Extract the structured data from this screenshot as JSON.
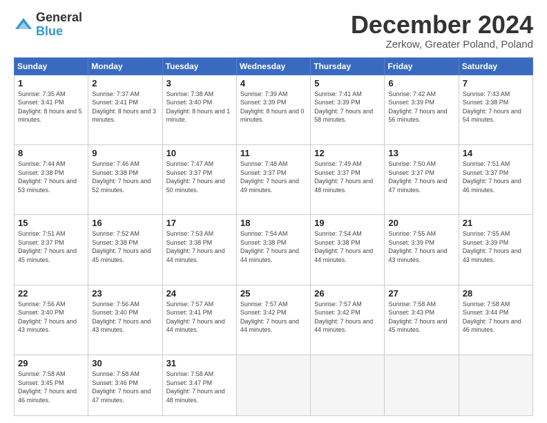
{
  "logo": {
    "general": "General",
    "blue": "Blue"
  },
  "header": {
    "title": "December 2024",
    "subtitle": "Zerkow, Greater Poland, Poland"
  },
  "weekdays": [
    "Sunday",
    "Monday",
    "Tuesday",
    "Wednesday",
    "Thursday",
    "Friday",
    "Saturday"
  ],
  "days": [
    {
      "num": "",
      "info": ""
    },
    {
      "num": "",
      "info": ""
    },
    {
      "num": "",
      "info": ""
    },
    {
      "num": "",
      "info": ""
    },
    {
      "num": "",
      "info": ""
    },
    {
      "num": "",
      "info": ""
    },
    {
      "num": "1",
      "sunrise": "Sunrise: 7:35 AM",
      "sunset": "Sunset: 3:41 PM",
      "daylight": "Daylight: 8 hours and 5 minutes."
    },
    {
      "num": "2",
      "sunrise": "Sunrise: 7:37 AM",
      "sunset": "Sunset: 3:41 PM",
      "daylight": "Daylight: 8 hours and 3 minutes."
    },
    {
      "num": "3",
      "sunrise": "Sunrise: 7:38 AM",
      "sunset": "Sunset: 3:40 PM",
      "daylight": "Daylight: 8 hours and 1 minute."
    },
    {
      "num": "4",
      "sunrise": "Sunrise: 7:39 AM",
      "sunset": "Sunset: 3:39 PM",
      "daylight": "Daylight: 8 hours and 0 minutes."
    },
    {
      "num": "5",
      "sunrise": "Sunrise: 7:41 AM",
      "sunset": "Sunset: 3:39 PM",
      "daylight": "Daylight: 7 hours and 58 minutes."
    },
    {
      "num": "6",
      "sunrise": "Sunrise: 7:42 AM",
      "sunset": "Sunset: 3:39 PM",
      "daylight": "Daylight: 7 hours and 56 minutes."
    },
    {
      "num": "7",
      "sunrise": "Sunrise: 7:43 AM",
      "sunset": "Sunset: 3:38 PM",
      "daylight": "Daylight: 7 hours and 54 minutes."
    },
    {
      "num": "8",
      "sunrise": "Sunrise: 7:44 AM",
      "sunset": "Sunset: 3:38 PM",
      "daylight": "Daylight: 7 hours and 53 minutes."
    },
    {
      "num": "9",
      "sunrise": "Sunrise: 7:46 AM",
      "sunset": "Sunset: 3:38 PM",
      "daylight": "Daylight: 7 hours and 52 minutes."
    },
    {
      "num": "10",
      "sunrise": "Sunrise: 7:47 AM",
      "sunset": "Sunset: 3:37 PM",
      "daylight": "Daylight: 7 hours and 50 minutes."
    },
    {
      "num": "11",
      "sunrise": "Sunrise: 7:48 AM",
      "sunset": "Sunset: 3:37 PM",
      "daylight": "Daylight: 7 hours and 49 minutes."
    },
    {
      "num": "12",
      "sunrise": "Sunrise: 7:49 AM",
      "sunset": "Sunset: 3:37 PM",
      "daylight": "Daylight: 7 hours and 48 minutes."
    },
    {
      "num": "13",
      "sunrise": "Sunrise: 7:50 AM",
      "sunset": "Sunset: 3:37 PM",
      "daylight": "Daylight: 7 hours and 47 minutes."
    },
    {
      "num": "14",
      "sunrise": "Sunrise: 7:51 AM",
      "sunset": "Sunset: 3:37 PM",
      "daylight": "Daylight: 7 hours and 46 minutes."
    },
    {
      "num": "15",
      "sunrise": "Sunrise: 7:51 AM",
      "sunset": "Sunset: 3:37 PM",
      "daylight": "Daylight: 7 hours and 45 minutes."
    },
    {
      "num": "16",
      "sunrise": "Sunrise: 7:52 AM",
      "sunset": "Sunset: 3:38 PM",
      "daylight": "Daylight: 7 hours and 45 minutes."
    },
    {
      "num": "17",
      "sunrise": "Sunrise: 7:53 AM",
      "sunset": "Sunset: 3:38 PM",
      "daylight": "Daylight: 7 hours and 44 minutes."
    },
    {
      "num": "18",
      "sunrise": "Sunrise: 7:54 AM",
      "sunset": "Sunset: 3:38 PM",
      "daylight": "Daylight: 7 hours and 44 minutes."
    },
    {
      "num": "19",
      "sunrise": "Sunrise: 7:54 AM",
      "sunset": "Sunset: 3:38 PM",
      "daylight": "Daylight: 7 hours and 44 minutes."
    },
    {
      "num": "20",
      "sunrise": "Sunrise: 7:55 AM",
      "sunset": "Sunset: 3:39 PM",
      "daylight": "Daylight: 7 hours and 43 minutes."
    },
    {
      "num": "21",
      "sunrise": "Sunrise: 7:55 AM",
      "sunset": "Sunset: 3:39 PM",
      "daylight": "Daylight: 7 hours and 43 minutes."
    },
    {
      "num": "22",
      "sunrise": "Sunrise: 7:56 AM",
      "sunset": "Sunset: 3:40 PM",
      "daylight": "Daylight: 7 hours and 43 minutes."
    },
    {
      "num": "23",
      "sunrise": "Sunrise: 7:56 AM",
      "sunset": "Sunset: 3:40 PM",
      "daylight": "Daylight: 7 hours and 43 minutes."
    },
    {
      "num": "24",
      "sunrise": "Sunrise: 7:57 AM",
      "sunset": "Sunset: 3:41 PM",
      "daylight": "Daylight: 7 hours and 44 minutes."
    },
    {
      "num": "25",
      "sunrise": "Sunrise: 7:57 AM",
      "sunset": "Sunset: 3:42 PM",
      "daylight": "Daylight: 7 hours and 44 minutes."
    },
    {
      "num": "26",
      "sunrise": "Sunrise: 7:57 AM",
      "sunset": "Sunset: 3:42 PM",
      "daylight": "Daylight: 7 hours and 44 minutes."
    },
    {
      "num": "27",
      "sunrise": "Sunrise: 7:58 AM",
      "sunset": "Sunset: 3:43 PM",
      "daylight": "Daylight: 7 hours and 45 minutes."
    },
    {
      "num": "28",
      "sunrise": "Sunrise: 7:58 AM",
      "sunset": "Sunset: 3:44 PM",
      "daylight": "Daylight: 7 hours and 46 minutes."
    },
    {
      "num": "29",
      "sunrise": "Sunrise: 7:58 AM",
      "sunset": "Sunset: 3:45 PM",
      "daylight": "Daylight: 7 hours and 46 minutes."
    },
    {
      "num": "30",
      "sunrise": "Sunrise: 7:58 AM",
      "sunset": "Sunset: 3:46 PM",
      "daylight": "Daylight: 7 hours and 47 minutes."
    },
    {
      "num": "31",
      "sunrise": "Sunrise: 7:58 AM",
      "sunset": "Sunset: 3:47 PM",
      "daylight": "Daylight: 7 hours and 48 minutes."
    }
  ]
}
